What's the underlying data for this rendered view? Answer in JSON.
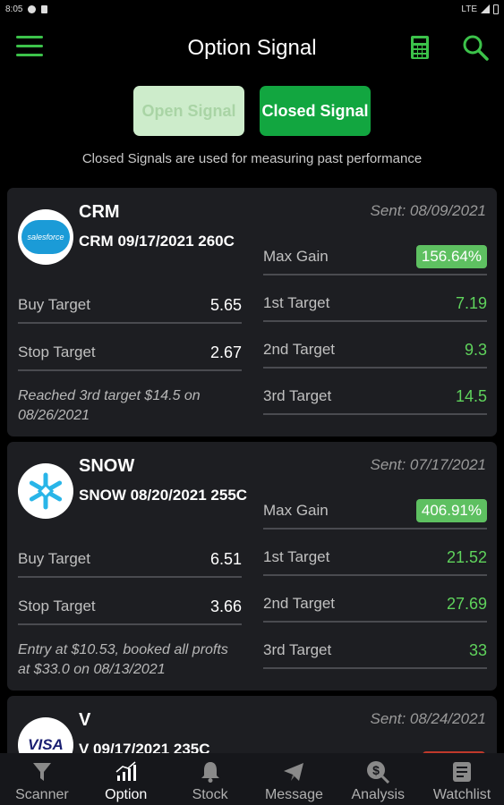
{
  "status_bar": {
    "time": "8:05",
    "network": "LTE"
  },
  "header": {
    "title": "Option Signal"
  },
  "toggle": {
    "open_label": "Open Signal",
    "closed_label": "Closed Signal"
  },
  "subtitle": "Closed Signals are used for measuring past performance",
  "labels": {
    "max_gain": "Max Gain",
    "buy_target": "Buy Target",
    "stop_target": "Stop Target",
    "first_target": "1st Target",
    "second_target": "2nd Target",
    "third_target": "3rd Target"
  },
  "cards": [
    {
      "ticker": "CRM",
      "logo_text": "salesforce",
      "contract": "CRM 09/17/2021 260C",
      "sent": "Sent: 08/09/2021",
      "max_gain": "156.64%",
      "buy_target": "5.65",
      "stop_target": "2.67",
      "first_target": "7.19",
      "second_target": "9.3",
      "third_target": "14.5",
      "note": "Reached 3rd target $14.5 on 08/26/2021"
    },
    {
      "ticker": "SNOW",
      "logo_text": "",
      "contract": "SNOW 08/20/2021 255C",
      "sent": "Sent: 07/17/2021",
      "max_gain": "406.91%",
      "buy_target": "6.51",
      "stop_target": "3.66",
      "first_target": "21.52",
      "second_target": "27.69",
      "third_target": "33",
      "note": "Entry at $10.53, booked all profts at $33.0 on 08/13/2021"
    },
    {
      "ticker": "V",
      "logo_text": "VISA",
      "contract": "V 09/17/2021 235C",
      "sent": "Sent: 08/24/2021"
    }
  ],
  "nav": [
    {
      "label": "Scanner",
      "icon": "filter-icon"
    },
    {
      "label": "Option",
      "icon": "bar-chart-icon"
    },
    {
      "label": "Stock",
      "icon": "bell-icon"
    },
    {
      "label": "Message",
      "icon": "send-icon"
    },
    {
      "label": "Analysis",
      "icon": "dollar-icon"
    },
    {
      "label": "Watchlist",
      "icon": "watchlist-icon"
    }
  ],
  "colors": {
    "accent": "#3cc24a",
    "closed_button": "#12a640",
    "open_button": "#cdeccb",
    "gain_badge": "#5ec061",
    "loss_badge": "#c0392b",
    "card": "#1d1e22"
  }
}
